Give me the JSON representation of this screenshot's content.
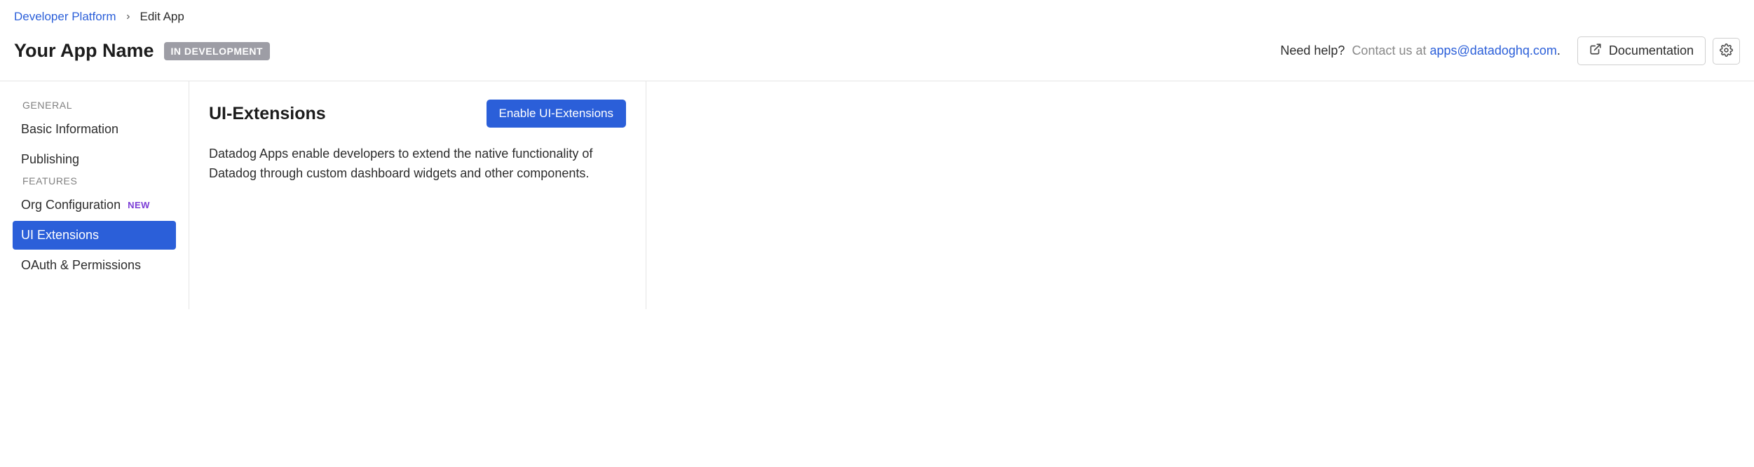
{
  "breadcrumb": {
    "root": "Developer Platform",
    "current": "Edit App"
  },
  "header": {
    "title": "Your App Name",
    "status_badge": "IN DEVELOPMENT",
    "help_label": "Need help?",
    "contact_label": "Contact us at ",
    "email": "apps@datadoghq.com",
    "period": ".",
    "documentation_label": "Documentation"
  },
  "sidebar": {
    "general_header": "GENERAL",
    "general_items": [
      {
        "label": "Basic Information"
      },
      {
        "label": "Publishing"
      }
    ],
    "features_header": "FEATURES",
    "features_items": [
      {
        "label": "Org Configuration",
        "new": "NEW"
      },
      {
        "label": "UI Extensions",
        "active": true
      },
      {
        "label": "OAuth & Permissions"
      }
    ]
  },
  "main": {
    "title": "UI-Extensions",
    "enable_button": "Enable UI-Extensions",
    "description": "Datadog Apps enable developers to extend the native functionality of Datadog through custom dashboard widgets and other components."
  }
}
